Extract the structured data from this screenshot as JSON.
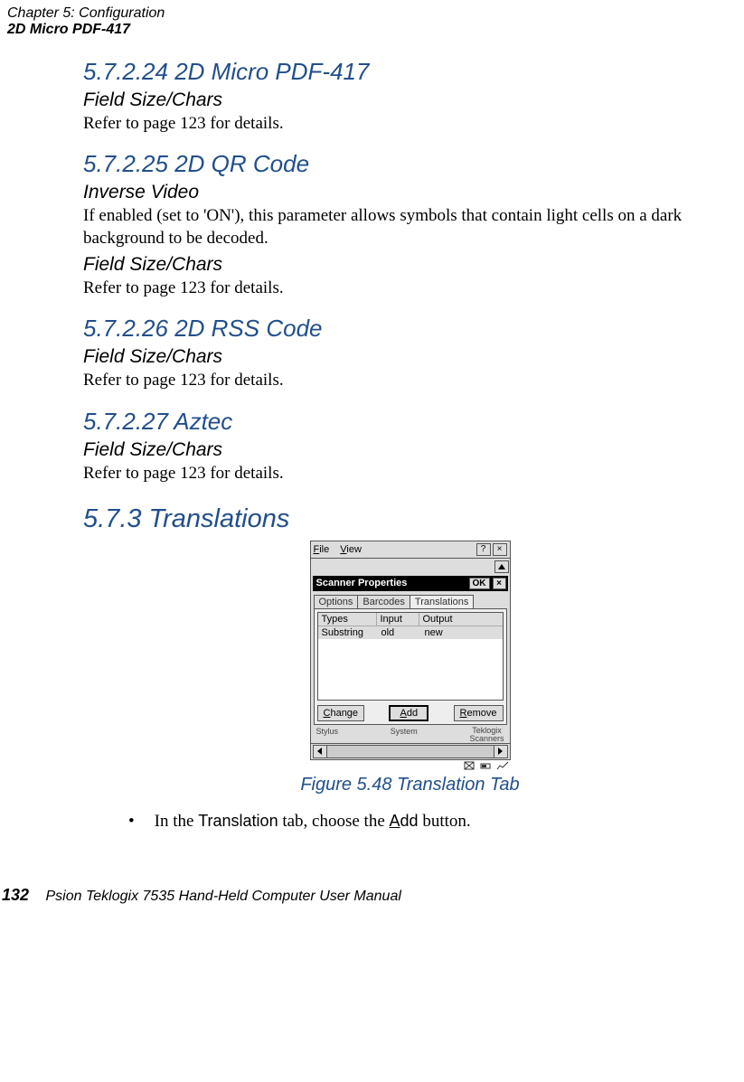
{
  "header": {
    "chapter": "Chapter 5: Configuration",
    "section_ref": "2D Micro PDF-417"
  },
  "sections": [
    {
      "num_title": "5.7.2.24   2D Micro PDF-417",
      "sub": "Field Size/Chars",
      "body": "Refer to page 123 for details."
    },
    {
      "num_title": "5.7.2.25   2D QR Code",
      "sub1": "Inverse Video",
      "body1": "If enabled (set to 'ON'), this parameter allows symbols that contain light cells on a dark background to be decoded.",
      "sub2": "Field Size/Chars",
      "body2": "Refer to page 123 for details."
    },
    {
      "num_title": "5.7.2.26   2D RSS Code",
      "sub": "Field Size/Chars",
      "body": "Refer to page 123 for details."
    },
    {
      "num_title": "5.7.2.27   Aztec",
      "sub": "Field Size/Chars",
      "body": "Refer to page 123 for details."
    }
  ],
  "translations_heading": "5.7.3  Translations",
  "screenshot": {
    "menu_file": "File",
    "menu_view": "View",
    "help": "?",
    "close": "×",
    "title": "Scanner Properties",
    "ok": "OK",
    "tab1": "Options",
    "tab2": "Barcodes",
    "tab3": "Translations",
    "col1": "Types",
    "col2": "Input",
    "col3": "Output",
    "row_type": "Substring",
    "row_input": "old",
    "row_output": "new",
    "btn_change": "Change",
    "btn_add": "Add",
    "btn_remove": "Remove",
    "task1": "Stylus",
    "task2": "System",
    "task3": "Teklogix\nScanners"
  },
  "figure_caption": "Figure 5.48 Translation Tab",
  "bullet_pre": "In the ",
  "bullet_mid1": "Translation",
  "bullet_mid2": " tab, choose the ",
  "bullet_add": "Add",
  "bullet_post": " button.",
  "footer": {
    "page": "132",
    "book": "Psion Teklogix 7535 Hand-Held Computer User Manual"
  }
}
